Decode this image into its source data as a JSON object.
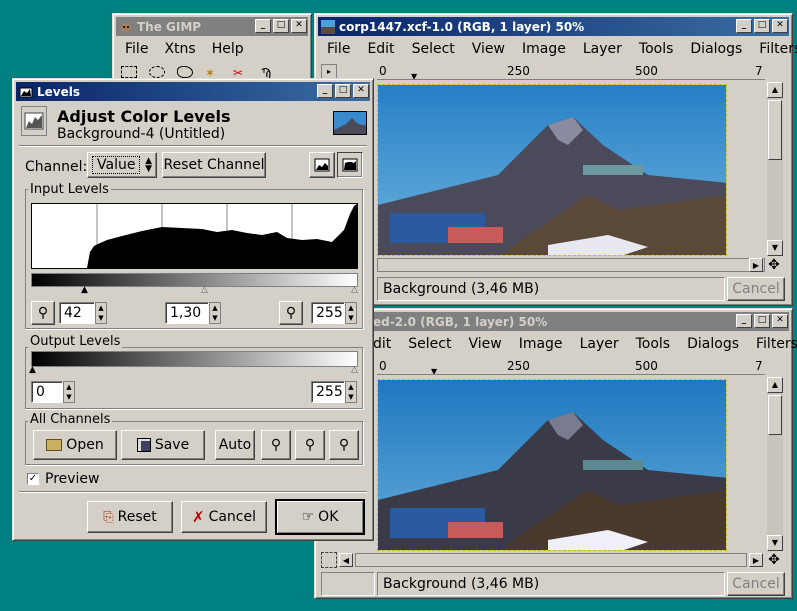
{
  "gimp_toolbox": {
    "title": "The GIMP",
    "menu": [
      "File",
      "Xtns",
      "Help"
    ]
  },
  "image_window_1": {
    "title": "corp1447.xcf-1.0 (RGB, 1 layer) 50%",
    "menu": [
      "File",
      "Edit",
      "Select",
      "View",
      "Image",
      "Layer",
      "Tools",
      "Dialogs",
      "Filters"
    ],
    "ruler_ticks": [
      "0",
      "250",
      "500",
      "7"
    ],
    "status": "Background (3,46 MB)",
    "cancel_label": "Cancel"
  },
  "image_window_2": {
    "title": "ed-2.0 (RGB, 1 layer) 50%",
    "menu": [
      "dit",
      "Select",
      "View",
      "Image",
      "Layer",
      "Tools",
      "Dialogs",
      "Filters"
    ],
    "ruler_ticks": [
      "0",
      "250",
      "500",
      "7"
    ],
    "status": "Background (3,46 MB)",
    "cancel_label": "Cancel"
  },
  "levels": {
    "title": "Levels",
    "heading": "Adjust Color Levels",
    "subheading": "Background-4 (Untitled)",
    "channel_label": "Channel:",
    "channel_value": "Value",
    "reset_channel": "Reset Channel",
    "input_levels_label": "Input Levels",
    "input_low": "42",
    "input_gamma": "1,30",
    "input_high": "255",
    "output_levels_label": "Output Levels",
    "output_low": "0",
    "output_high": "255",
    "all_channels_label": "All Channels",
    "open_label": "Open",
    "save_label": "Save",
    "auto_label": "Auto",
    "preview_label": "Preview",
    "preview_checked": true,
    "reset_label": "Reset",
    "cancel_label": "Cancel",
    "ok_label": "OK"
  },
  "colors": {
    "desktop": "#008080",
    "active_title": "#0a246a",
    "inactive_title": "#808080",
    "face": "#d4d0c8"
  }
}
